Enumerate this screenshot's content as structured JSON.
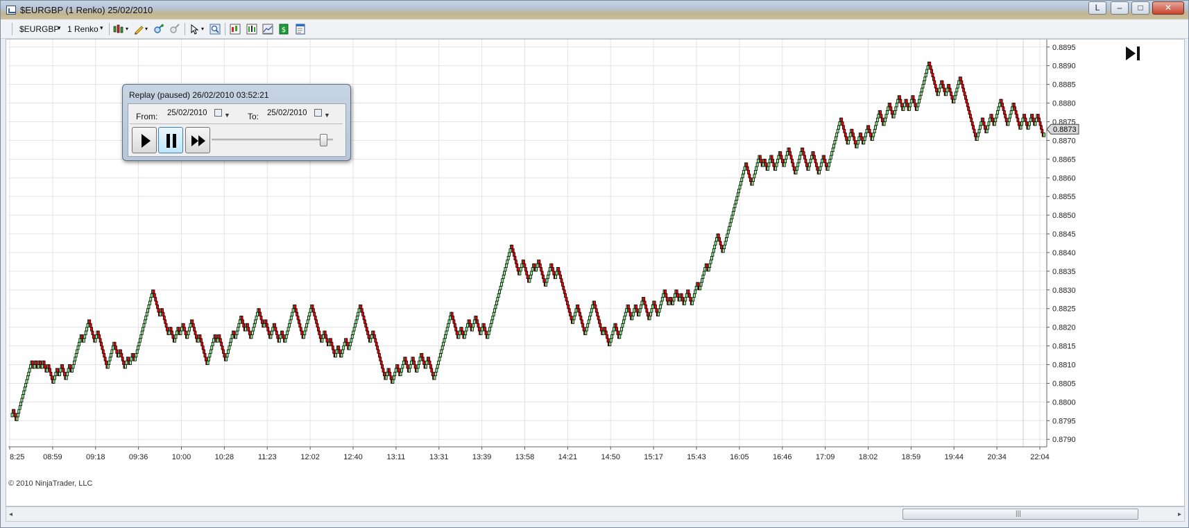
{
  "window": {
    "title": "$EURGBP (1 Renko)  25/02/2010",
    "btn_l": "L",
    "btn_min": "–",
    "btn_max": "□",
    "btn_close": "✕"
  },
  "toolbar": {
    "instrument": "$EURGBP",
    "interval": "1 Renko",
    "dropdown_glyph": "▾",
    "icons": [
      "bar-type-icon",
      "drawing-pencil-icon",
      "zoom-in-icon",
      "zoom-out-icon",
      "cursor-icon",
      "magnifier-icon",
      "chart-properties-icon",
      "indicators-icon",
      "strategies-icon",
      "data-box-icon",
      "order-ticket-icon"
    ]
  },
  "replay": {
    "title": "Replay (paused) 26/02/2010 03:52:21",
    "from_label": "From:",
    "from_value": "25/02/2010",
    "to_label": "To:",
    "to_value": "25/02/2010",
    "speed_fraction": 0.95
  },
  "copyright": "© 2010 NinjaTrader, LLC",
  "scrollbar": {
    "left_arrow": "◂",
    "right_arrow": "▸",
    "grip": "|||"
  },
  "colors": {
    "up_brick": "#90ee90",
    "down_brick": "#ff0000",
    "outline": "#000000",
    "grid": "#e3e3e3",
    "last_price_bg": "#d8d8d8"
  },
  "chart_data": {
    "type": "renko",
    "brick_size": 0.0001,
    "ylim": [
      0.8788,
      0.8897
    ],
    "y_ticks": [
      "0.8895",
      "0.8890",
      "0.8885",
      "0.8880",
      "0.8875",
      "0.8870",
      "0.8865",
      "0.8860",
      "0.8855",
      "0.8850",
      "0.8845",
      "0.8840",
      "0.8835",
      "0.8830",
      "0.8825",
      "0.8820",
      "0.8815",
      "0.8810",
      "0.8805",
      "0.8800",
      "0.8795",
      "0.8790"
    ],
    "x_ticks": [
      "8:25",
      "08:59",
      "09:18",
      "09:36",
      "10:00",
      "10:28",
      "11:23",
      "12:02",
      "12:40",
      "13:11",
      "13:31",
      "13:39",
      "13:58",
      "14:21",
      "14:50",
      "15:17",
      "15:43",
      "16:05",
      "16:46",
      "17:09",
      "18:02",
      "18:59",
      "19:44",
      "20:34",
      "22:04"
    ],
    "last_price": "0.8873",
    "pivots": [
      0.8796,
      0.8798,
      0.8795,
      0.8811,
      0.8809,
      0.8811,
      0.8809,
      0.8811,
      0.8809,
      0.8811,
      0.8808,
      0.881,
      0.8805,
      0.8809,
      0.8807,
      0.881,
      0.8806,
      0.881,
      0.8808,
      0.8818,
      0.8816,
      0.8822,
      0.8816,
      0.8819,
      0.8809,
      0.8816,
      0.8812,
      0.8814,
      0.8809,
      0.8812,
      0.881,
      0.8813,
      0.8811,
      0.8813,
      0.883,
      0.8823,
      0.8825,
      0.8818,
      0.882,
      0.8816,
      0.882,
      0.8818,
      0.8821,
      0.8817,
      0.8822,
      0.8816,
      0.8818,
      0.881,
      0.8816,
      0.8818,
      0.8816,
      0.8818,
      0.8811,
      0.8819,
      0.8817,
      0.8823,
      0.8819,
      0.8821,
      0.8817,
      0.8825,
      0.882,
      0.8822,
      0.8817,
      0.8821,
      0.8816,
      0.8819,
      0.8816,
      0.8826,
      0.8817,
      0.8826,
      0.882,
      0.8816,
      0.8819,
      0.8815,
      0.8817,
      0.8812,
      0.8815,
      0.8812,
      0.8817,
      0.8814,
      0.8822,
      0.8826,
      0.8816,
      0.8819,
      0.8815,
      0.8806,
      0.8809,
      0.8805,
      0.881,
      0.8807,
      0.8812,
      0.8808,
      0.8812,
      0.8808,
      0.8813,
      0.8809,
      0.8812,
      0.8806,
      0.8811,
      0.8816,
      0.8819,
      0.8824,
      0.8817,
      0.882,
      0.8817,
      0.8822,
      0.8819,
      0.8823,
      0.8818,
      0.8821,
      0.8817,
      0.8826,
      0.8831,
      0.8842,
      0.8839,
      0.8834,
      0.8838,
      0.8832,
      0.8837,
      0.8835,
      0.8838,
      0.8831,
      0.8837,
      0.8833,
      0.8836,
      0.8829,
      0.8821,
      0.8826,
      0.8822,
      0.8822,
      0.8818,
      0.8821,
      0.8822,
      0.8827,
      0.8818,
      0.882,
      0.8815,
      0.8821,
      0.8817,
      0.8818,
      0.8826,
      0.8822,
      0.8826,
      0.8823,
      0.8828,
      0.8822,
      0.8827,
      0.8823,
      0.883,
      0.8826,
      0.8828,
      0.8826,
      0.883,
      0.8827,
      0.8829,
      0.8826,
      0.883,
      0.8826,
      0.8832,
      0.883,
      0.8837,
      0.8835,
      0.8845,
      0.884,
      0.8842,
      0.8864,
      0.8858,
      0.8861,
      0.8866,
      0.8863,
      0.8865,
      0.8862,
      0.8866,
      0.8862,
      0.8867,
      0.8863,
      0.8868,
      0.8861,
      0.8868,
      0.8862,
      0.8867,
      0.8861,
      0.8866,
      0.8862,
      0.8866,
      0.8876,
      0.8869,
      0.8873,
      0.8868,
      0.8872,
      0.8869,
      0.8874,
      0.887,
      0.8878,
      0.8874,
      0.888,
      0.8876,
      0.8882,
      0.8878,
      0.8881,
      0.8878,
      0.8882,
      0.8878,
      0.8891,
      0.8884,
      0.8882,
      0.8886,
      0.8882,
      0.8885,
      0.888,
      0.8887,
      0.8884,
      0.8884,
      0.888,
      0.8878,
      0.8874,
      0.887,
      0.8876,
      0.8872,
      0.8877,
      0.8874,
      0.8881,
      0.8874,
      0.888,
      0.8873,
      0.8877,
      0.8873,
      0.8874,
      0.8877,
      0.8874,
      0.8877,
      0.8871,
      0.8872
    ]
  }
}
